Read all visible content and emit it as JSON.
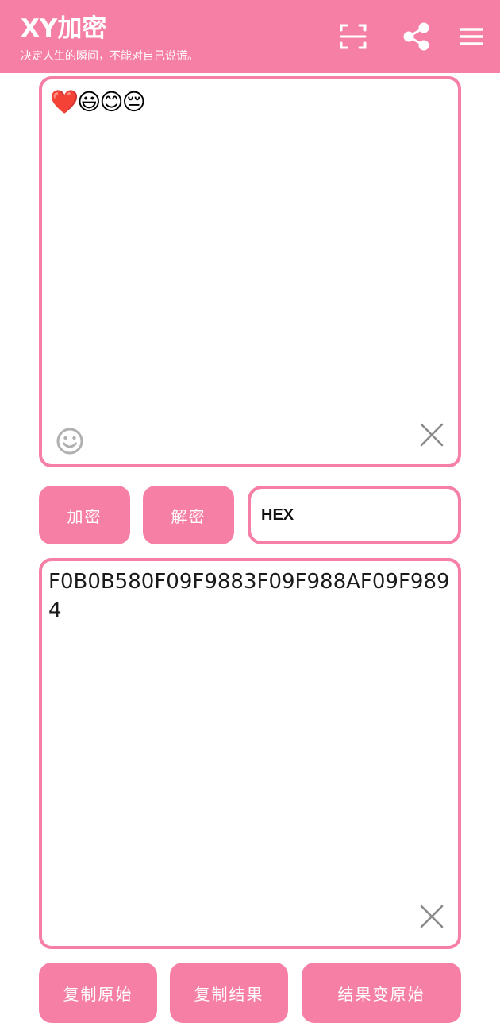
{
  "app": {
    "title": "XY加密",
    "subtitle": "决定人生的瞬间，不能对自己说谎。",
    "accent_color": "#F67FA5"
  },
  "toolbar": {
    "icons": [
      "scan-icon",
      "share-icon",
      "menu-icon"
    ]
  },
  "input": {
    "text": "❤️😃😊😔"
  },
  "actions": {
    "encrypt_label": "加密",
    "decrypt_label": "解密",
    "format_value": "HEX"
  },
  "output": {
    "text": "F0B0B580F09F9883F09F988AF09F9894"
  },
  "bottom_actions": {
    "copy_original_label": "复制原始",
    "copy_result_label": "复制结果",
    "result_to_original_label": "结果变原始"
  }
}
